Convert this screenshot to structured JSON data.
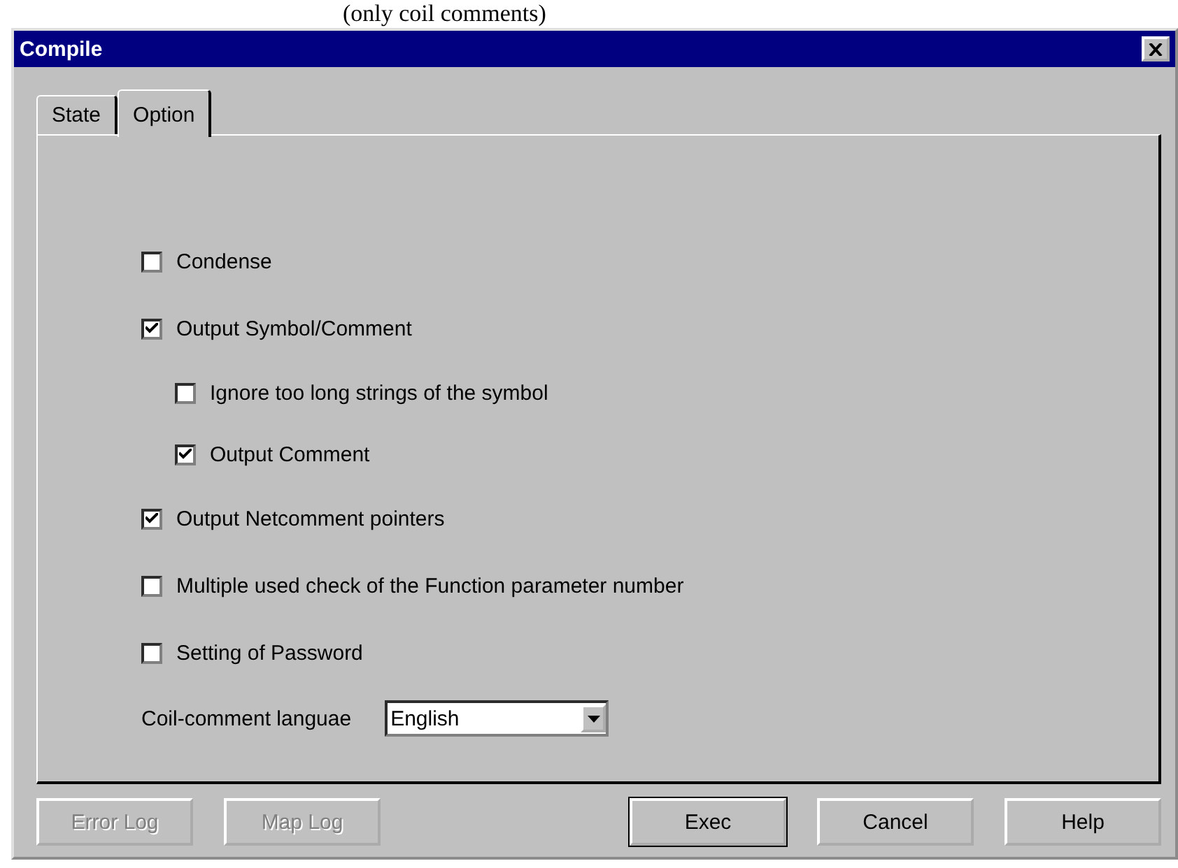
{
  "caption_above": "(only coil comments)",
  "window": {
    "title": "Compile"
  },
  "tabs": [
    {
      "label": "State",
      "selected": false
    },
    {
      "label": "Option",
      "selected": true
    }
  ],
  "options": [
    {
      "label": "Condense",
      "checked": false
    },
    {
      "label": "Output Symbol/Comment",
      "checked": true,
      "children": [
        {
          "label": "Ignore too long strings of the symbol",
          "checked": false
        },
        {
          "label": "Output Comment",
          "checked": true
        }
      ]
    },
    {
      "label": "Output Netcomment pointers",
      "checked": true
    },
    {
      "label": "Multiple used check of the Function parameter number",
      "checked": false
    },
    {
      "label": "Setting of Password",
      "checked": false
    }
  ],
  "language": {
    "label": "Coil-comment languae",
    "value": "English"
  },
  "buttons": [
    {
      "label": "Error Log",
      "disabled": true,
      "default": false
    },
    {
      "label": "Map Log",
      "disabled": true,
      "default": false
    },
    {
      "label": "Exec",
      "disabled": false,
      "default": true
    },
    {
      "label": "Cancel",
      "disabled": false,
      "default": false
    },
    {
      "label": "Help",
      "disabled": false,
      "default": false
    }
  ]
}
